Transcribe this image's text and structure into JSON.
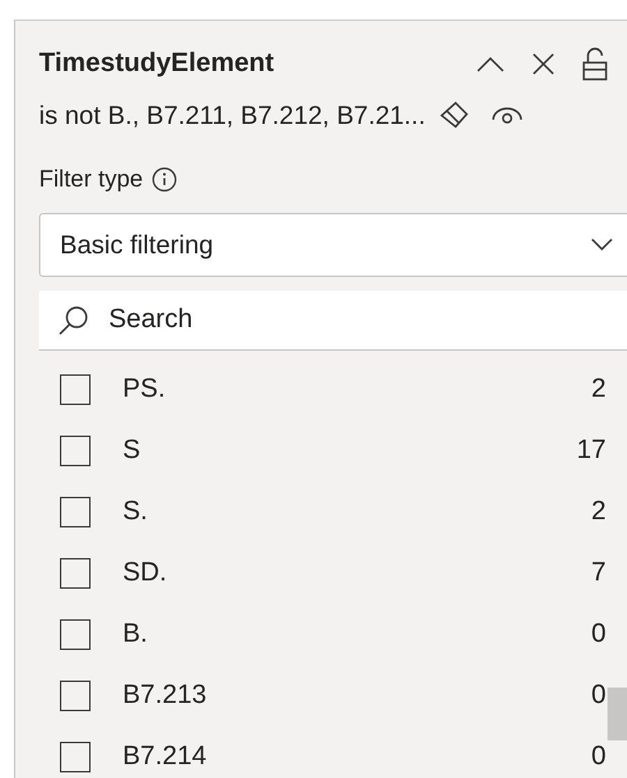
{
  "filter": {
    "title": "TimestudyElement",
    "summary": "is not B., B7.211, B7.212, B7.21...",
    "filter_type_label": "Filter type",
    "filter_type": "Basic filtering",
    "search": {
      "placeholder": "Search"
    },
    "values": [
      {
        "label": "PS.",
        "count": "2",
        "checked": false
      },
      {
        "label": "S",
        "count": "17",
        "checked": false
      },
      {
        "label": "S.",
        "count": "2",
        "checked": false
      },
      {
        "label": "SD.",
        "count": "7",
        "checked": false
      },
      {
        "label": "B.",
        "count": "0",
        "checked": false
      },
      {
        "label": "B7.213",
        "count": "0",
        "checked": false
      },
      {
        "label": "B7.214",
        "count": "0",
        "checked": false
      }
    ]
  }
}
